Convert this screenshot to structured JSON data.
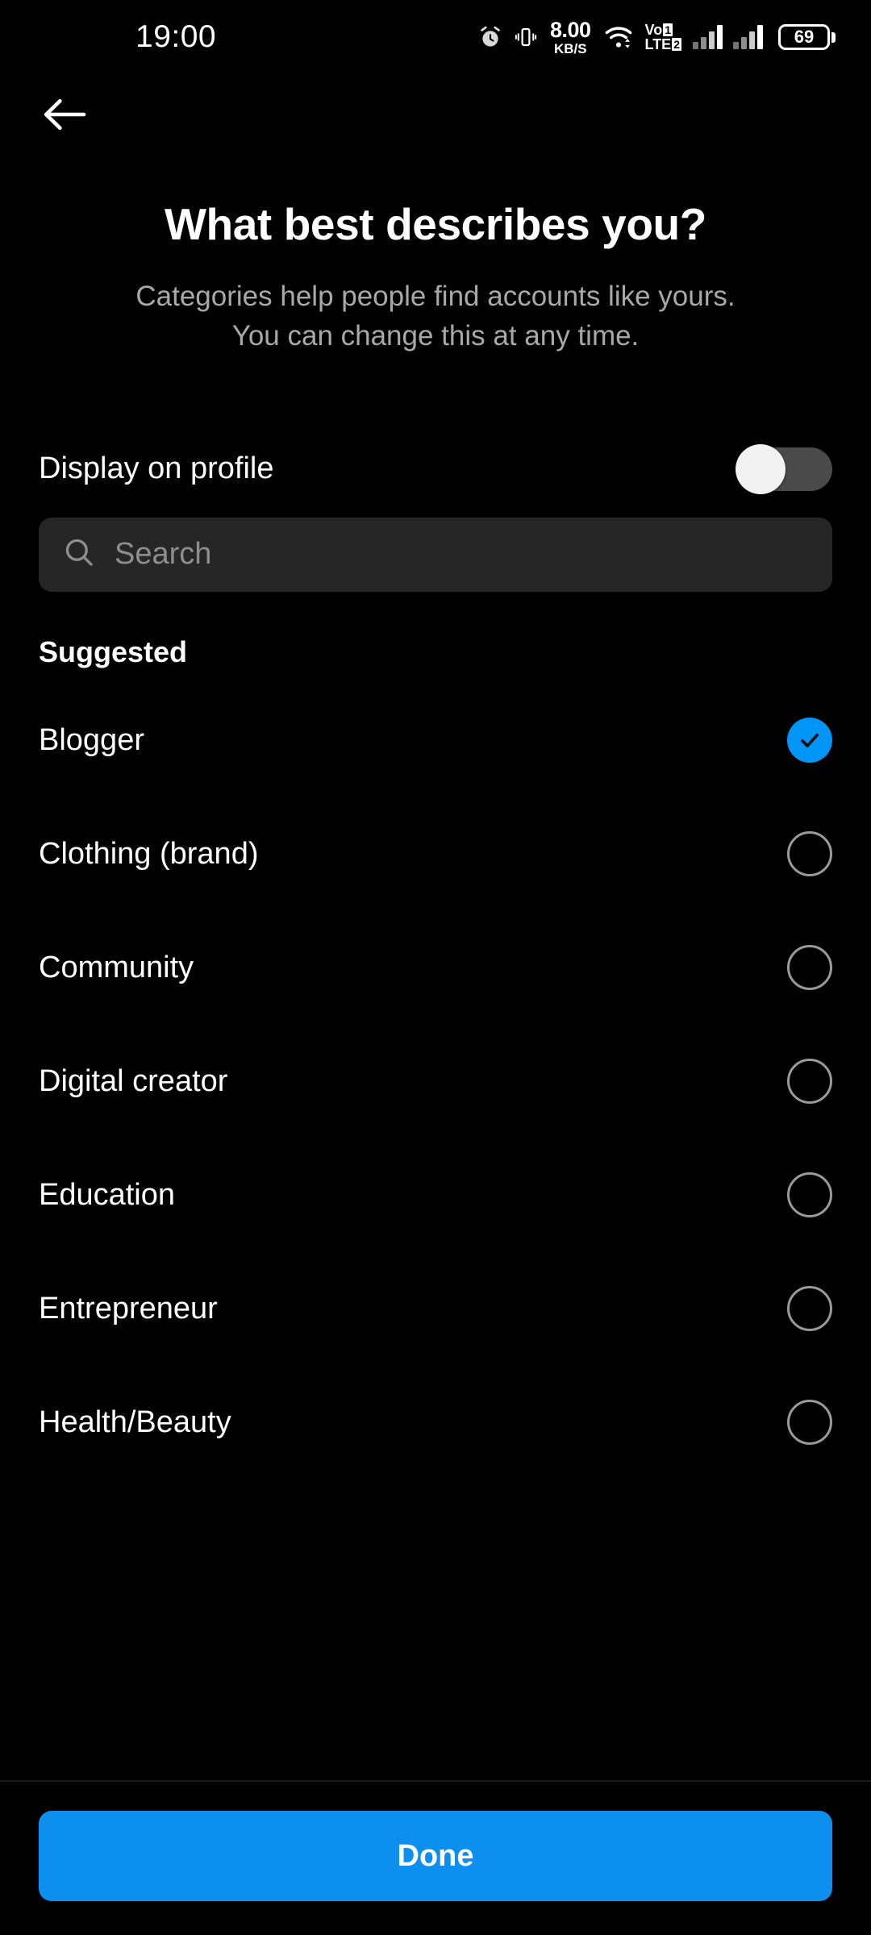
{
  "status_bar": {
    "time": "19:00",
    "alarm_icon": "alarm-clock-icon",
    "vibrate_icon": "vibrate-icon",
    "network_speed_value": "8.00",
    "network_speed_unit": "KB/S",
    "wifi_icon": "wifi-icon",
    "volte_top": "Vo",
    "volte_bottom": "LTE",
    "volte_sim1": "1",
    "volte_sim2": "2",
    "battery_level": "69"
  },
  "nav": {
    "back_icon": "back-arrow-icon"
  },
  "header": {
    "title": "What best describes you?",
    "subtitle_line1": "Categories help people find accounts like yours.",
    "subtitle_line2": "You can change this at any time."
  },
  "display_on_profile": {
    "label": "Display on profile",
    "toggle_state": "off"
  },
  "search": {
    "placeholder": "Search",
    "value": "",
    "icon": "search-icon"
  },
  "list": {
    "section_title": "Suggested",
    "items": [
      {
        "label": "Blogger",
        "selected": true
      },
      {
        "label": "Clothing (brand)",
        "selected": false
      },
      {
        "label": "Community",
        "selected": false
      },
      {
        "label": "Digital creator",
        "selected": false
      },
      {
        "label": "Education",
        "selected": false
      },
      {
        "label": "Entrepreneur",
        "selected": false
      },
      {
        "label": "Health/Beauty",
        "selected": false
      }
    ]
  },
  "footer": {
    "done_label": "Done"
  },
  "colors": {
    "background": "#000000",
    "accent_blue": "#0095f6",
    "button_blue": "#0d8ff0",
    "secondary_text": "#a8a8a8",
    "search_bg": "#262626",
    "radio_border": "#9a9a9a",
    "toggle_track": "#4a4a4a"
  }
}
